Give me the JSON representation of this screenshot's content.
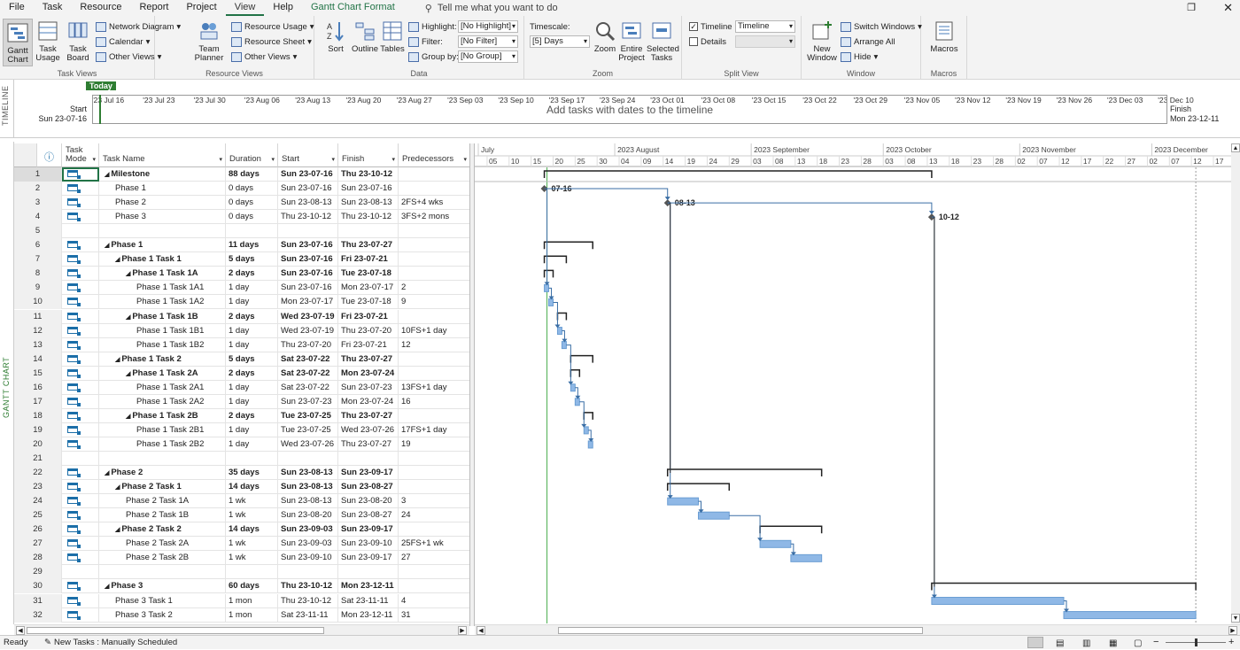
{
  "menu": {
    "items": [
      "File",
      "Task",
      "Resource",
      "Report",
      "Project",
      "View",
      "Help"
    ],
    "active": "View",
    "gantt_format": "Gantt Chart Format",
    "tellme": "Tell me what you want to do"
  },
  "ribbon": {
    "task_views": {
      "label": "Task Views",
      "gantt_chart": "Gantt Chart",
      "task_usage": "Task Usage",
      "task_board": "Task Board",
      "network_diagram": "Network Diagram",
      "calendar": "Calendar",
      "other_views": "Other Views"
    },
    "resource_views": {
      "label": "Resource Views",
      "team_planner": "Team Planner",
      "resource_usage": "Resource Usage",
      "resource_sheet": "Resource Sheet",
      "other_views": "Other Views"
    },
    "data": {
      "label": "Data",
      "sort": "Sort",
      "outline": "Outline",
      "tables": "Tables",
      "highlight_label": "Highlight:",
      "highlight_value": "[No Highlight]",
      "filter_label": "Filter:",
      "filter_value": "[No Filter]",
      "group_label": "Group by:",
      "group_value": "[No Group]"
    },
    "zoom": {
      "label": "Zoom",
      "timescale_label": "Timescale:",
      "timescale_value": "[5] Days",
      "zoom": "Zoom",
      "entire_project": "Entire Project",
      "selected_tasks": "Selected Tasks"
    },
    "split_view": {
      "label": "Split View",
      "timeline": "Timeline",
      "timeline_value": "Timeline",
      "details": "Details"
    },
    "window": {
      "label": "Window",
      "new_window": "New Window",
      "switch_windows": "Switch Windows",
      "arrange_all": "Arrange All",
      "hide": "Hide"
    },
    "macros": {
      "label": "Macros",
      "macros": "Macros"
    }
  },
  "timeline": {
    "side_label": "TIMELINE",
    "today": "Today",
    "start_label": "Start",
    "start_date": "Sun 23-07-16",
    "finish_label": "Finish",
    "finish_date": "Mon 23-12-11",
    "placeholder": "Add tasks with dates to the timeline",
    "dates": [
      "'23 Jul 16",
      "'23 Jul 23",
      "'23 Jul 30",
      "'23 Aug 06",
      "'23 Aug 13",
      "'23 Aug 20",
      "'23 Aug 27",
      "'23 Sep 03",
      "'23 Sep 10",
      "'23 Sep 17",
      "'23 Sep 24",
      "'23 Oct 01",
      "'23 Oct 08",
      "'23 Oct 15",
      "'23 Oct 22",
      "'23 Oct 29",
      "'23 Nov 05",
      "'23 Nov 12",
      "'23 Nov 19",
      "'23 Nov 26",
      "'23 Dec 03",
      "'23 Dec 10"
    ]
  },
  "gantt": {
    "side_label": "GANTT CHART",
    "columns": {
      "info": "ⓘ",
      "mode": "Task Mode",
      "name": "Task Name",
      "duration": "Duration",
      "start": "Start",
      "finish": "Finish",
      "pred": "Predecessors"
    },
    "months": [
      "July",
      "2023 August",
      "2023 September",
      "2023 October",
      "2023 November",
      "2023 December"
    ],
    "days": [
      "05",
      "10",
      "15",
      "20",
      "25",
      "30",
      "04",
      "09",
      "14",
      "19",
      "24",
      "29",
      "03",
      "08",
      "13",
      "18",
      "23",
      "28",
      "03",
      "08",
      "13",
      "18",
      "23",
      "28",
      "02",
      "07",
      "12",
      "17",
      "22",
      "27",
      "02",
      "07",
      "12",
      "17",
      "2"
    ],
    "milestone_labels": [
      "07-16",
      "08-13",
      "10-12"
    ],
    "rows": [
      {
        "id": "1",
        "name": "Milestone",
        "level": 0,
        "summary": true,
        "dur": "88 days",
        "start": "Sun 23-07-16",
        "finish": "Thu 23-10-12",
        "pred": ""
      },
      {
        "id": "2",
        "name": "Phase 1",
        "level": 1,
        "summary": false,
        "dur": "0 days",
        "start": "Sun 23-07-16",
        "finish": "Sun 23-07-16",
        "pred": ""
      },
      {
        "id": "3",
        "name": "Phase 2",
        "level": 1,
        "summary": false,
        "dur": "0 days",
        "start": "Sun 23-08-13",
        "finish": "Sun 23-08-13",
        "pred": "2FS+4 wks"
      },
      {
        "id": "4",
        "name": "Phase 3",
        "level": 1,
        "summary": false,
        "dur": "0 days",
        "start": "Thu 23-10-12",
        "finish": "Thu 23-10-12",
        "pred": "3FS+2 mons"
      },
      {
        "id": "5",
        "name": "",
        "level": 0,
        "summary": false,
        "dur": "",
        "start": "",
        "finish": "",
        "pred": ""
      },
      {
        "id": "6",
        "name": "Phase 1",
        "level": 0,
        "summary": true,
        "dur": "11 days",
        "start": "Sun 23-07-16",
        "finish": "Thu 23-07-27",
        "pred": ""
      },
      {
        "id": "7",
        "name": "Phase 1 Task 1",
        "level": 1,
        "summary": true,
        "dur": "5 days",
        "start": "Sun 23-07-16",
        "finish": "Fri 23-07-21",
        "pred": ""
      },
      {
        "id": "8",
        "name": "Phase 1 Task 1A",
        "level": 2,
        "summary": true,
        "dur": "2 days",
        "start": "Sun 23-07-16",
        "finish": "Tue 23-07-18",
        "pred": ""
      },
      {
        "id": "9",
        "name": "Phase 1 Task 1A1",
        "level": 3,
        "summary": false,
        "dur": "1 day",
        "start": "Sun 23-07-16",
        "finish": "Mon 23-07-17",
        "pred": "2"
      },
      {
        "id": "10",
        "name": "Phase 1 Task 1A2",
        "level": 3,
        "summary": false,
        "dur": "1 day",
        "start": "Mon 23-07-17",
        "finish": "Tue 23-07-18",
        "pred": "9"
      },
      {
        "id": "11",
        "name": "Phase 1 Task 1B",
        "level": 2,
        "summary": true,
        "dur": "2 days",
        "start": "Wed 23-07-19",
        "finish": "Fri 23-07-21",
        "pred": ""
      },
      {
        "id": "12",
        "name": "Phase 1 Task 1B1",
        "level": 3,
        "summary": false,
        "dur": "1 day",
        "start": "Wed 23-07-19",
        "finish": "Thu 23-07-20",
        "pred": "10FS+1 day"
      },
      {
        "id": "13",
        "name": "Phase 1 Task 1B2",
        "level": 3,
        "summary": false,
        "dur": "1 day",
        "start": "Thu 23-07-20",
        "finish": "Fri 23-07-21",
        "pred": "12"
      },
      {
        "id": "14",
        "name": "Phase 1 Task 2",
        "level": 1,
        "summary": true,
        "dur": "5 days",
        "start": "Sat 23-07-22",
        "finish": "Thu 23-07-27",
        "pred": ""
      },
      {
        "id": "15",
        "name": "Phase 1 Task 2A",
        "level": 2,
        "summary": true,
        "dur": "2 days",
        "start": "Sat 23-07-22",
        "finish": "Mon 23-07-24",
        "pred": ""
      },
      {
        "id": "16",
        "name": "Phase 1 Task 2A1",
        "level": 3,
        "summary": false,
        "dur": "1 day",
        "start": "Sat 23-07-22",
        "finish": "Sun 23-07-23",
        "pred": "13FS+1 day"
      },
      {
        "id": "17",
        "name": "Phase 1 Task 2A2",
        "level": 3,
        "summary": false,
        "dur": "1 day",
        "start": "Sun 23-07-23",
        "finish": "Mon 23-07-24",
        "pred": "16"
      },
      {
        "id": "18",
        "name": "Phase 1 Task 2B",
        "level": 2,
        "summary": true,
        "dur": "2 days",
        "start": "Tue 23-07-25",
        "finish": "Thu 23-07-27",
        "pred": ""
      },
      {
        "id": "19",
        "name": "Phase 1 Task 2B1",
        "level": 3,
        "summary": false,
        "dur": "1 day",
        "start": "Tue 23-07-25",
        "finish": "Wed 23-07-26",
        "pred": "17FS+1 day"
      },
      {
        "id": "20",
        "name": "Phase 1 Task 2B2",
        "level": 3,
        "summary": false,
        "dur": "1 day",
        "start": "Wed 23-07-26",
        "finish": "Thu 23-07-27",
        "pred": "19"
      },
      {
        "id": "21",
        "name": "",
        "level": 0,
        "summary": false,
        "dur": "",
        "start": "",
        "finish": "",
        "pred": ""
      },
      {
        "id": "22",
        "name": "Phase 2",
        "level": 0,
        "summary": true,
        "dur": "35 days",
        "start": "Sun 23-08-13",
        "finish": "Sun 23-09-17",
        "pred": ""
      },
      {
        "id": "23",
        "name": "Phase 2 Task 1",
        "level": 1,
        "summary": true,
        "dur": "14 days",
        "start": "Sun 23-08-13",
        "finish": "Sun 23-08-27",
        "pred": ""
      },
      {
        "id": "24",
        "name": "Phase 2 Task 1A",
        "level": 2,
        "summary": false,
        "dur": "1 wk",
        "start": "Sun 23-08-13",
        "finish": "Sun 23-08-20",
        "pred": "3"
      },
      {
        "id": "25",
        "name": "Phase 2 Task 1B",
        "level": 2,
        "summary": false,
        "dur": "1 wk",
        "start": "Sun 23-08-20",
        "finish": "Sun 23-08-27",
        "pred": "24"
      },
      {
        "id": "26",
        "name": "Phase 2 Task 2",
        "level": 1,
        "summary": true,
        "dur": "14 days",
        "start": "Sun 23-09-03",
        "finish": "Sun 23-09-17",
        "pred": ""
      },
      {
        "id": "27",
        "name": "Phase 2 Task 2A",
        "level": 2,
        "summary": false,
        "dur": "1 wk",
        "start": "Sun 23-09-03",
        "finish": "Sun 23-09-10",
        "pred": "25FS+1 wk"
      },
      {
        "id": "28",
        "name": "Phase 2 Task 2B",
        "level": 2,
        "summary": false,
        "dur": "1 wk",
        "start": "Sun 23-09-10",
        "finish": "Sun 23-09-17",
        "pred": "27"
      },
      {
        "id": "29",
        "name": "",
        "level": 0,
        "summary": false,
        "dur": "",
        "start": "",
        "finish": "",
        "pred": ""
      },
      {
        "id": "30",
        "name": "Phase 3",
        "level": 0,
        "summary": true,
        "dur": "60 days",
        "start": "Thu 23-10-12",
        "finish": "Mon 23-12-11",
        "pred": ""
      },
      {
        "id": "31",
        "name": "Phase 3 Task 1",
        "level": 1,
        "summary": false,
        "dur": "1 mon",
        "start": "Thu 23-10-12",
        "finish": "Sat 23-11-11",
        "pred": "4"
      },
      {
        "id": "32",
        "name": "Phase 3 Task 2",
        "level": 1,
        "summary": false,
        "dur": "1 mon",
        "start": "Sat 23-11-11",
        "finish": "Mon 23-12-11",
        "pred": "31"
      }
    ]
  },
  "status": {
    "ready": "Ready",
    "new_tasks": "New Tasks : Manually Scheduled"
  },
  "colors": {
    "accent": "#217346",
    "bar": "#8fb8e6",
    "today": "#2e7d32"
  }
}
